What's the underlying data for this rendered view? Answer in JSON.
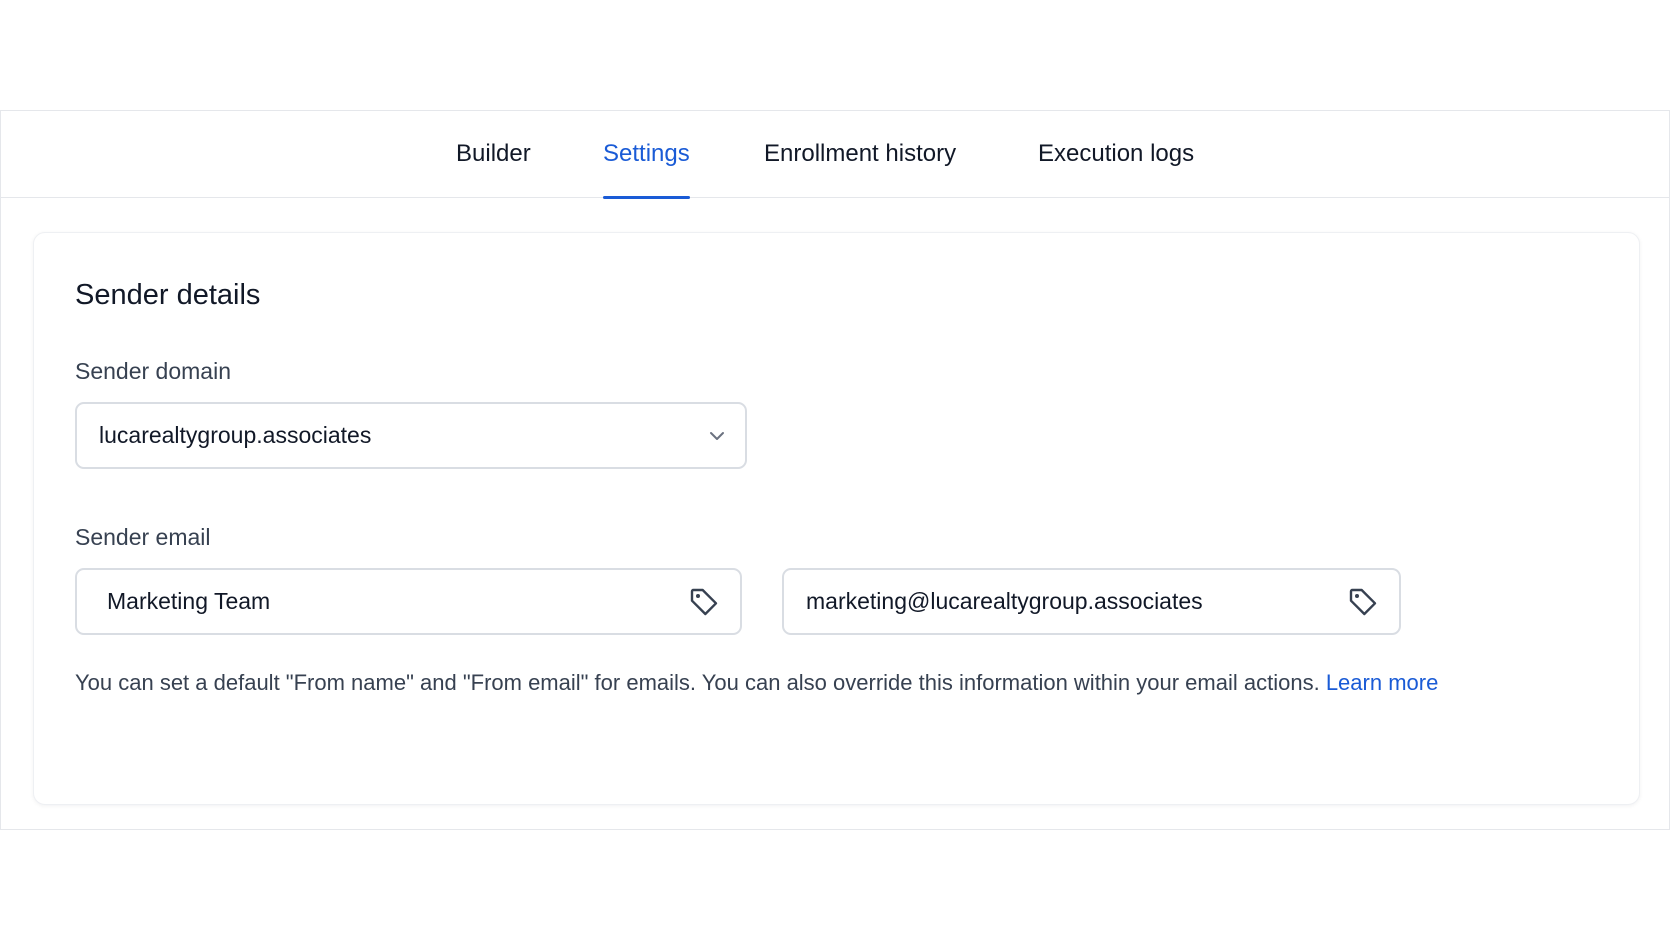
{
  "tabs": [
    {
      "label": "Builder",
      "active": false
    },
    {
      "label": "Settings",
      "active": true
    },
    {
      "label": "Enrollment history",
      "active": false
    },
    {
      "label": "Execution logs",
      "active": false
    }
  ],
  "sender_details": {
    "title": "Sender details",
    "domain": {
      "label": "Sender domain",
      "value": "lucarealtygroup.associates",
      "icon": "chevron-down-icon"
    },
    "email": {
      "label": "Sender email",
      "from_name": {
        "value": "Marketing Team",
        "icon": "tag-icon"
      },
      "from_email": {
        "value": "marketing@lucarealtygroup.associates",
        "icon": "tag-icon"
      }
    },
    "helper_text": "You can set a default \"From name\" and \"From email\" for emails. You can also override this information within your email actions.",
    "learn_more": "Learn more"
  },
  "colors": {
    "accent": "#1a5bd6",
    "border": "#d9dde3",
    "text": "#111827",
    "muted_text": "#374151"
  }
}
